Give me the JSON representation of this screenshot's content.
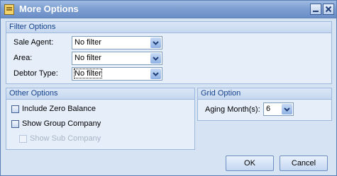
{
  "window": {
    "title": "More Options"
  },
  "filter_options": {
    "header": "Filter Options",
    "sale_agent": {
      "label": "Sale Agent:",
      "value": "No filter"
    },
    "area": {
      "label": "Area:",
      "value": "No filter"
    },
    "debtor_type": {
      "label": "Debtor Type:",
      "value": "No filter"
    }
  },
  "other_options": {
    "header": "Other Options",
    "include_zero_balance": {
      "label": "Include Zero Balance",
      "checked": false
    },
    "show_group_company": {
      "label": "Show Group Company",
      "checked": false
    },
    "show_sub_company": {
      "label": "Show Sub Company",
      "checked": false,
      "enabled": false
    }
  },
  "grid_option": {
    "header": "Grid Option",
    "aging_months": {
      "label": "Aging Month(s):",
      "value": "6"
    }
  },
  "buttons": {
    "ok": "OK",
    "cancel": "Cancel"
  },
  "icons": [
    "window-app-icon",
    "minimize-icon",
    "close-icon",
    "chevron-down-icon"
  ]
}
